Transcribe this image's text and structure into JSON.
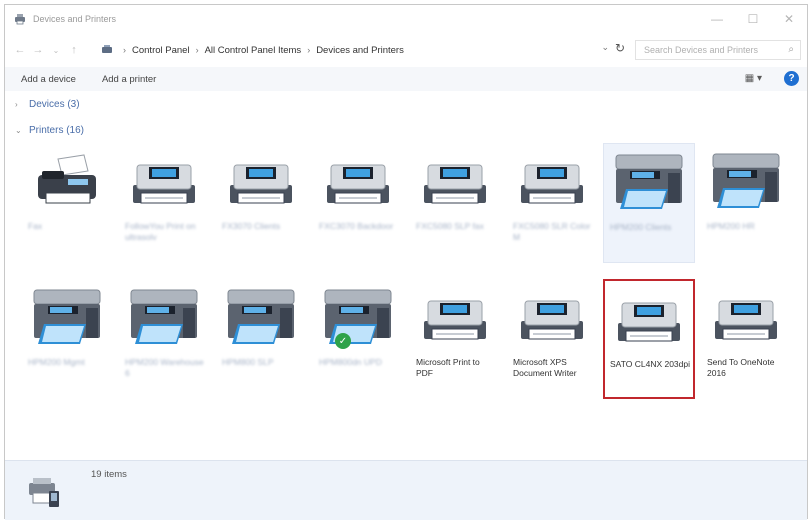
{
  "window": {
    "title": "Devices and Printers",
    "controls": {
      "minimize": "—",
      "maximize": "☐",
      "close": "✕"
    }
  },
  "nav": {
    "back": "←",
    "forward": "→",
    "up": "↑"
  },
  "breadcrumb": [
    "Control Panel",
    "All Control Panel Items",
    "Devices and Printers"
  ],
  "search": {
    "placeholder": "Search Devices and Printers"
  },
  "toolbar": {
    "add_device": "Add a device",
    "add_printer": "Add a printer"
  },
  "groups": {
    "devices": {
      "label": "Devices (3)",
      "expanded": false
    },
    "printers": {
      "label": "Printers (16)",
      "expanded": true
    }
  },
  "printers": [
    {
      "label": "Fax",
      "icon": "fax-icon",
      "blurred": true
    },
    {
      "label": "FollowYou Print on ultrasolv",
      "icon": "laser-printer-icon",
      "blurred": true
    },
    {
      "label": "FX3070 Clients",
      "icon": "laser-printer-icon",
      "blurred": true
    },
    {
      "label": "FXC3070 Backdoor",
      "icon": "laser-printer-icon",
      "blurred": true
    },
    {
      "label": "FXC5080 SLP fax",
      "icon": "laser-printer-icon",
      "blurred": true
    },
    {
      "label": "FXC5080 SLR Color M",
      "icon": "laser-printer-icon",
      "blurred": true
    },
    {
      "label": "HPM200 Clients",
      "icon": "mfp-printer-icon",
      "blurred": true,
      "selected": true
    },
    {
      "label": "HPM200 HR",
      "icon": "mfp-printer-icon",
      "blurred": true
    },
    {
      "label": "HPM200 Mgmt",
      "icon": "mfp-printer-icon",
      "blurred": true
    },
    {
      "label": "HPM200 Warehouse 6",
      "icon": "mfp-printer-icon",
      "blurred": true
    },
    {
      "label": "HPM800 SLP",
      "icon": "mfp-printer-icon",
      "blurred": true
    },
    {
      "label": "HPM800dn UPD",
      "icon": "mfp-printer-icon",
      "blurred": true,
      "default": true
    },
    {
      "label": "Microsoft Print to PDF",
      "icon": "laser-printer-icon",
      "blurred": false
    },
    {
      "label": "Microsoft XPS Document Writer",
      "icon": "laser-printer-icon",
      "blurred": false
    },
    {
      "label": "SATO CL4NX 203dpi",
      "icon": "laser-printer-icon",
      "blurred": false,
      "highlighted": true
    },
    {
      "label": "Send To OneNote 2016",
      "icon": "laser-printer-icon",
      "blurred": false
    }
  ],
  "status": {
    "count": "19 items"
  },
  "colors": {
    "accent": "#1f6fd1",
    "highlight_border": "#c1272d",
    "default_check": "#2fa24a",
    "toolbar_bg": "#f5f7fa",
    "status_bg": "#eef3fa"
  }
}
